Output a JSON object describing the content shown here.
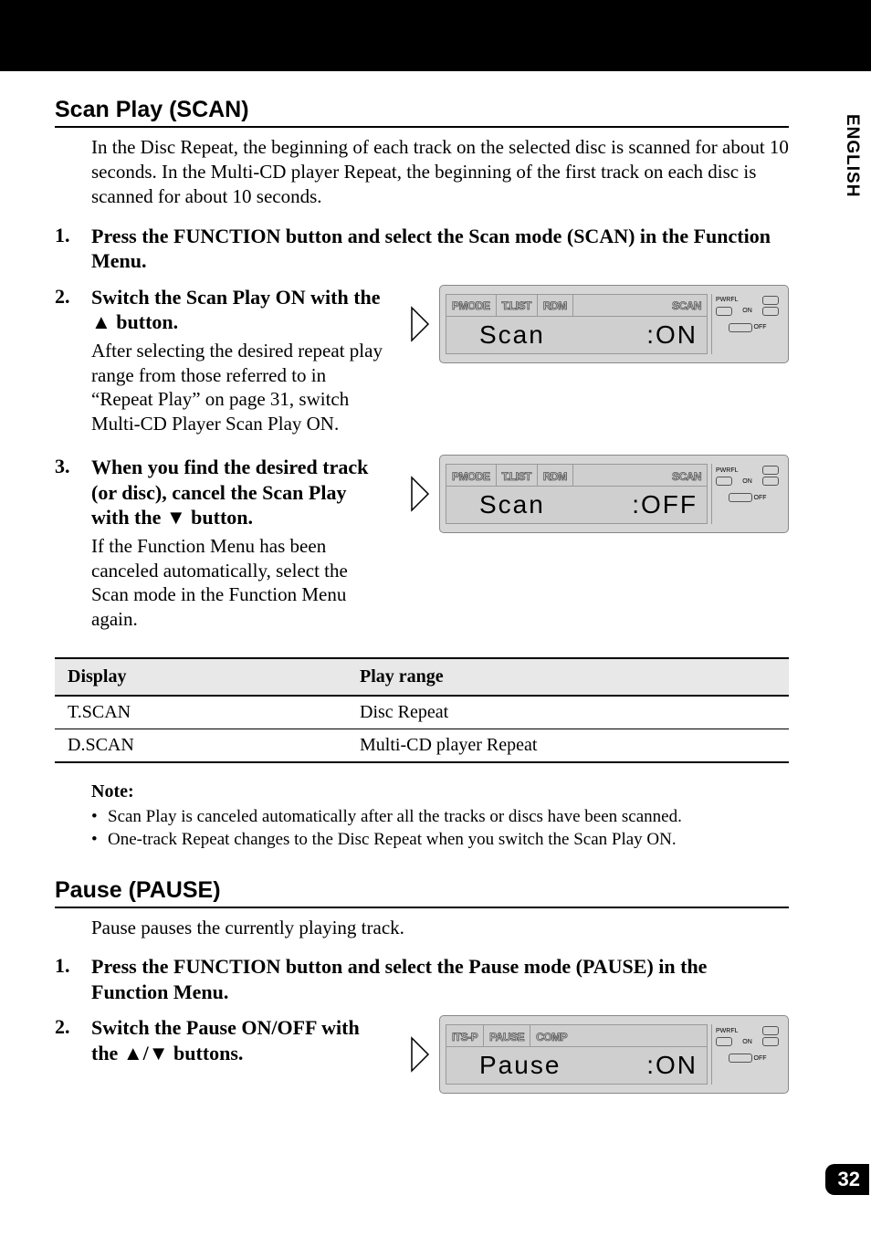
{
  "language_tab": "ENGLISH",
  "page_number": "32",
  "section1": {
    "title": "Scan Play (SCAN)",
    "intro": "In the Disc Repeat, the beginning of each track on the selected disc is scanned for about 10 seconds. In the Multi-CD player Repeat, the beginning of the first track on each disc is scanned for about 10 seconds.",
    "steps": [
      {
        "num": "1.",
        "title": "Press the FUNCTION button and select the Scan mode (SCAN) in the Function Menu."
      },
      {
        "num": "2.",
        "title_prefix": "Switch the Scan Play ON with the ",
        "title_suffix": " button.",
        "text": "After selecting the desired repeat play range from those referred to in “Repeat Play” on page 31, switch Multi-CD Player Scan Play ON.",
        "display": {
          "tabs": [
            "PMODE",
            "T.LIST",
            "RDM"
          ],
          "active_tab": "SCAN",
          "label": "Scan",
          "value": ":ON",
          "indicators": {
            "pwrfl": "PWRFL",
            "on": "ON",
            "off": "OFF"
          }
        }
      },
      {
        "num": "3.",
        "title_prefix": "When you find the desired track (or disc), cancel the Scan Play with the ",
        "title_suffix": " button.",
        "text": "If the Function Menu has been canceled automatically, select the Scan mode in the Function Menu again.",
        "display": {
          "tabs": [
            "PMODE",
            "T.LIST",
            "RDM"
          ],
          "active_tab": "SCAN",
          "label": "Scan",
          "value": ":OFF",
          "indicators": {
            "pwrfl": "PWRFL",
            "on": "ON",
            "off": "OFF"
          }
        }
      }
    ],
    "table": {
      "headers": [
        "Display",
        "Play range"
      ],
      "rows": [
        [
          "T.SCAN",
          "Disc Repeat"
        ],
        [
          "D.SCAN",
          "Multi-CD player Repeat"
        ]
      ]
    },
    "note": {
      "title": "Note:",
      "items": [
        "Scan Play is canceled automatically after all the tracks or discs have been scanned.",
        "One-track Repeat changes to the Disc Repeat when you switch the Scan Play ON."
      ]
    }
  },
  "section2": {
    "title": "Pause (PAUSE)",
    "intro": "Pause pauses the currently playing track.",
    "steps": [
      {
        "num": "1.",
        "title": "Press the FUNCTION button and select the Pause mode (PAUSE) in the Function Menu."
      },
      {
        "num": "2.",
        "title_prefix": "Switch the Pause ON/OFF with the ",
        "title_suffix": " buttons.",
        "display": {
          "tabs": [
            "ITS-P",
            "PAUSE",
            "COMP"
          ],
          "active_tab": "PAUSE",
          "label": "Pause",
          "value": ":ON",
          "indicators": {
            "pwrfl": "PWRFL",
            "on": "ON",
            "off": "OFF"
          }
        }
      }
    ]
  }
}
